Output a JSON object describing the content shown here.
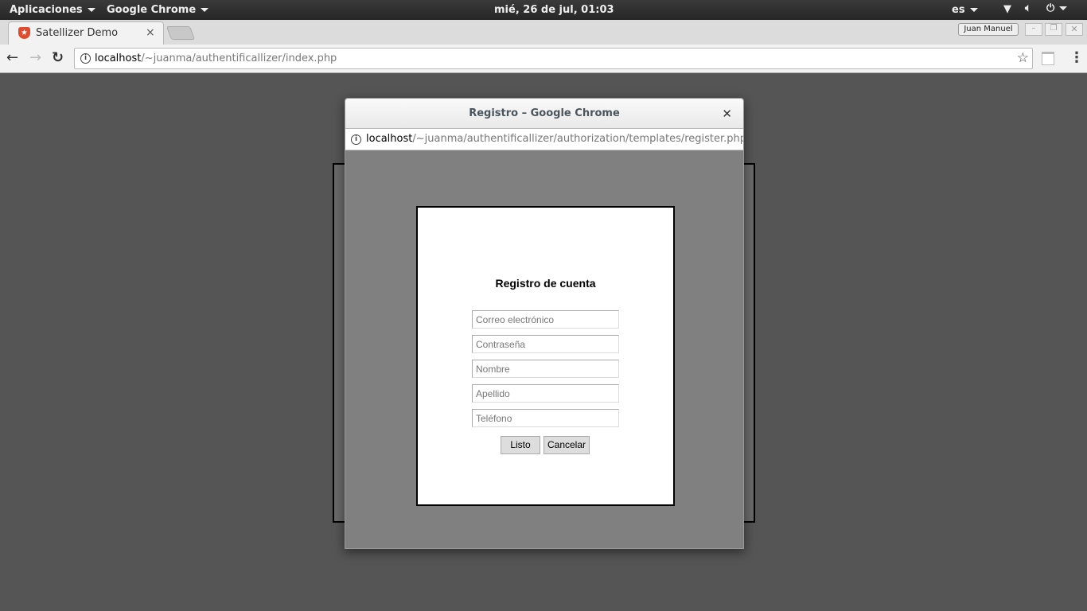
{
  "system_bar": {
    "apps_menu": "Aplicaciones",
    "app_menu": "Google Chrome",
    "clock": "mié, 26 de jul, 01:03",
    "language": "es"
  },
  "browser": {
    "tab_title": "Satellizer Demo",
    "user": "Juan Manuel",
    "url_host": "localhost",
    "url_path": "/~juanma/authentificallizer/index.php"
  },
  "popup": {
    "title": "Registro – Google Chrome",
    "url_host": "localhost",
    "url_path": "/~juanma/authentificallizer/authorization/templates/register.php",
    "form": {
      "heading": "Registro de cuenta",
      "fields": [
        {
          "placeholder": "Correo electrónico"
        },
        {
          "placeholder": "Contraseña"
        },
        {
          "placeholder": "Nombre"
        },
        {
          "placeholder": "Apellido"
        },
        {
          "placeholder": "Teléfono"
        }
      ],
      "submit": "Listo",
      "cancel": "Cancelar"
    }
  }
}
